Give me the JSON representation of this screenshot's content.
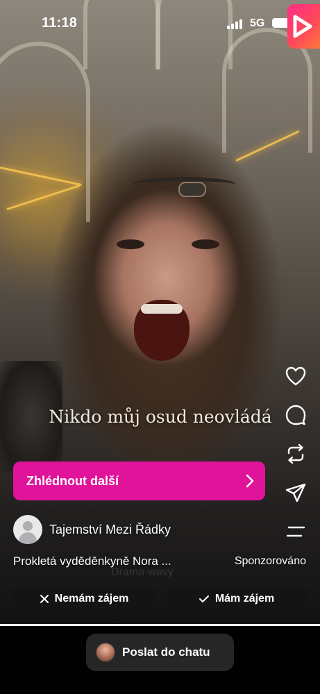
{
  "status_bar": {
    "time": "11:18",
    "network": "5G"
  },
  "video": {
    "caption": "Nikdo můj osud neovládá",
    "progress": 1.0
  },
  "side_actions": [
    "heart-icon",
    "comment-icon",
    "repost-icon",
    "share-icon",
    "more-icon"
  ],
  "cta": {
    "label": "Zhlédnout další",
    "color": "#e0139b"
  },
  "account": {
    "name": "Tajemství Mezi Řádky"
  },
  "post": {
    "description": "Prokletá vyděděnkyně Nora ...",
    "sponsored": "Sponzorováno",
    "ghost_text": "Drama·wavy"
  },
  "feedback": {
    "not_interested": "Nemám zájem",
    "interested": "Mám zájem"
  },
  "bottom": {
    "send_to_chat": "Poslat do chatu"
  }
}
